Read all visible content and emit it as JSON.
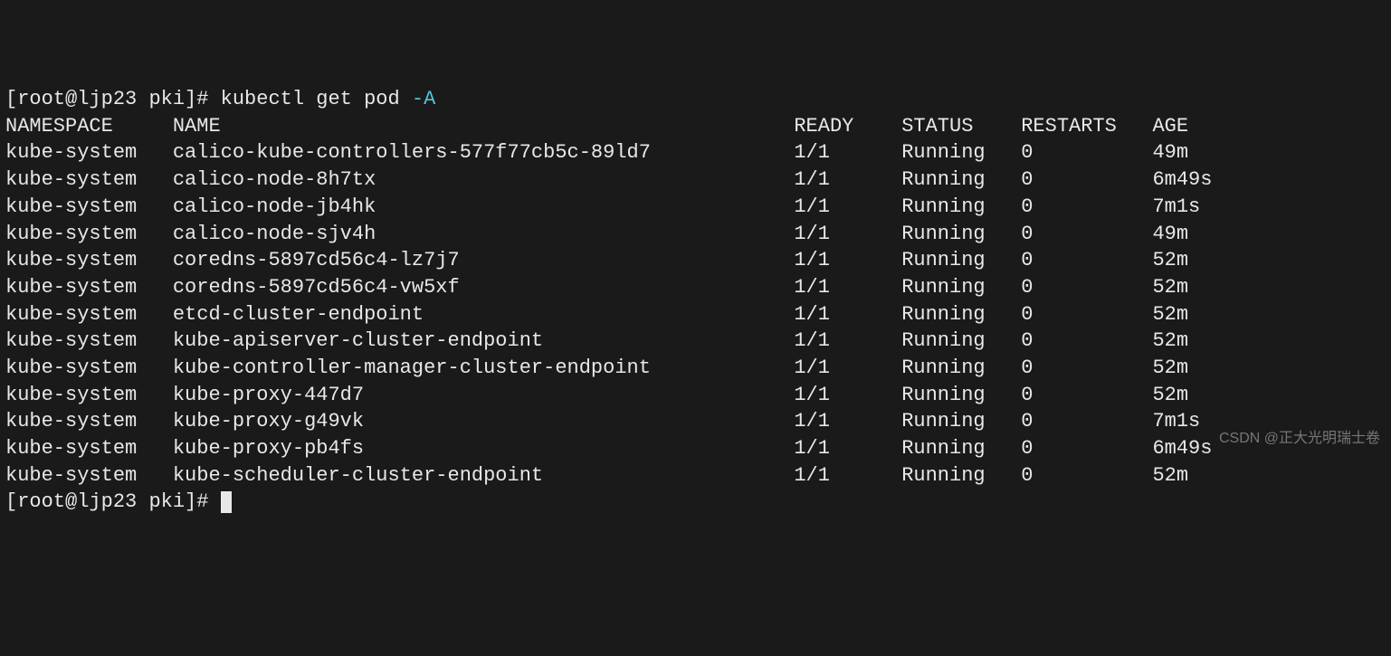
{
  "prompt": {
    "open_bracket": "[",
    "user_host": "root@ljp23",
    "path": "pki",
    "close_bracket": "]",
    "symbol": "#"
  },
  "command": {
    "cmd": "kubectl get pod",
    "flag": "-A"
  },
  "headers": {
    "namespace": "NAMESPACE",
    "name": "NAME",
    "ready": "READY",
    "status": "STATUS",
    "restarts": "RESTARTS",
    "age": "AGE"
  },
  "rows": [
    {
      "namespace": "kube-system",
      "name": "calico-kube-controllers-577f77cb5c-89ld7",
      "ready": "1/1",
      "status": "Running",
      "restarts": "0",
      "age": "49m"
    },
    {
      "namespace": "kube-system",
      "name": "calico-node-8h7tx",
      "ready": "1/1",
      "status": "Running",
      "restarts": "0",
      "age": "6m49s"
    },
    {
      "namespace": "kube-system",
      "name": "calico-node-jb4hk",
      "ready": "1/1",
      "status": "Running",
      "restarts": "0",
      "age": "7m1s"
    },
    {
      "namespace": "kube-system",
      "name": "calico-node-sjv4h",
      "ready": "1/1",
      "status": "Running",
      "restarts": "0",
      "age": "49m"
    },
    {
      "namespace": "kube-system",
      "name": "coredns-5897cd56c4-lz7j7",
      "ready": "1/1",
      "status": "Running",
      "restarts": "0",
      "age": "52m"
    },
    {
      "namespace": "kube-system",
      "name": "coredns-5897cd56c4-vw5xf",
      "ready": "1/1",
      "status": "Running",
      "restarts": "0",
      "age": "52m"
    },
    {
      "namespace": "kube-system",
      "name": "etcd-cluster-endpoint",
      "ready": "1/1",
      "status": "Running",
      "restarts": "0",
      "age": "52m"
    },
    {
      "namespace": "kube-system",
      "name": "kube-apiserver-cluster-endpoint",
      "ready": "1/1",
      "status": "Running",
      "restarts": "0",
      "age": "52m"
    },
    {
      "namespace": "kube-system",
      "name": "kube-controller-manager-cluster-endpoint",
      "ready": "1/1",
      "status": "Running",
      "restarts": "0",
      "age": "52m"
    },
    {
      "namespace": "kube-system",
      "name": "kube-proxy-447d7",
      "ready": "1/1",
      "status": "Running",
      "restarts": "0",
      "age": "52m"
    },
    {
      "namespace": "kube-system",
      "name": "kube-proxy-g49vk",
      "ready": "1/1",
      "status": "Running",
      "restarts": "0",
      "age": "7m1s"
    },
    {
      "namespace": "kube-system",
      "name": "kube-proxy-pb4fs",
      "ready": "1/1",
      "status": "Running",
      "restarts": "0",
      "age": "6m49s"
    },
    {
      "namespace": "kube-system",
      "name": "kube-scheduler-cluster-endpoint",
      "ready": "1/1",
      "status": "Running",
      "restarts": "0",
      "age": "52m"
    }
  ],
  "col_widths": {
    "namespace": 14,
    "name": 52,
    "ready": 9,
    "status": 10,
    "restarts": 11
  },
  "watermark": "CSDN @正大光明瑞士卷"
}
